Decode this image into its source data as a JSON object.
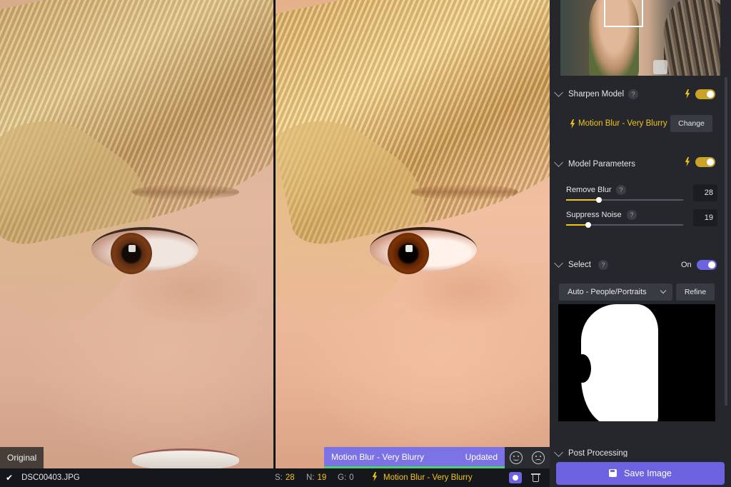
{
  "viewer": {
    "original_label": "Original",
    "model_bar": {
      "model": "Motion Blur - Very Blurry",
      "status": "Updated",
      "progress": 1.0
    },
    "feedback": {
      "like": "smile-icon",
      "dislike": "frown-icon"
    }
  },
  "statusbar": {
    "filename": "DSC00403.JPG",
    "s_label": "S:",
    "s_value": "28",
    "n_label": "N:",
    "n_value": "19",
    "g_label": "G:",
    "g_value": "0",
    "model": "Motion Blur - Very Blurry"
  },
  "panel": {
    "sharpen": {
      "title": "Sharpen Model",
      "help": "?",
      "enabled": true,
      "model": "Motion Blur - Very Blurry",
      "change_label": "Change"
    },
    "params": {
      "title": "Model Parameters",
      "enabled": true,
      "remove_blur": {
        "label": "Remove Blur",
        "help": "?",
        "value": "28",
        "fraction": 0.28
      },
      "suppress_noise": {
        "label": "Suppress Noise",
        "help": "?",
        "value": "19",
        "fraction": 0.19
      }
    },
    "select": {
      "title": "Select",
      "help": "?",
      "state": "On",
      "dropdown": "Auto - People/Portraits",
      "refine_label": "Refine"
    },
    "post_processing": {
      "title": "Post Processing"
    },
    "save_label": "Save Image"
  },
  "colors": {
    "accent": "#6d62e0",
    "highlight": "#f0c419",
    "panel": "#25272d"
  }
}
